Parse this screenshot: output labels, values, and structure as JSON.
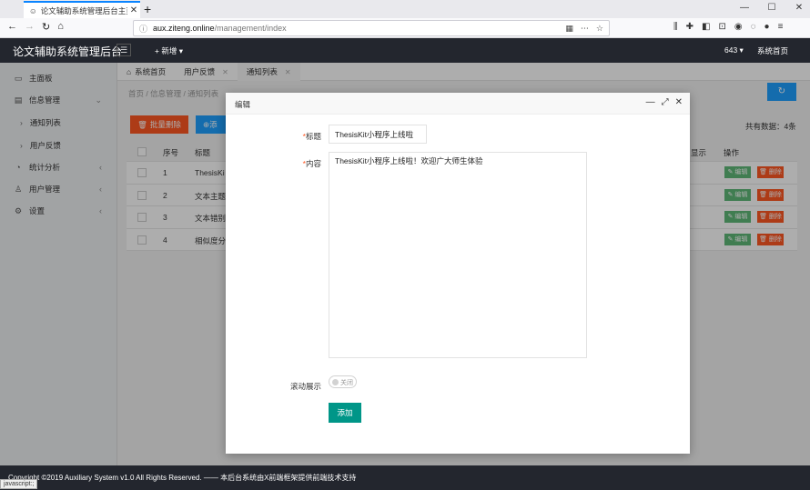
{
  "browser": {
    "tab_title": "论文辅助系统管理后台主页",
    "url_host": "aux.ziteng.online",
    "url_path": "/management/index"
  },
  "app": {
    "logo": "论文辅助系统管理后台",
    "add_new": "+ 新增",
    "user": "643",
    "home_link": "系统首页"
  },
  "sidebar": {
    "items": [
      {
        "label": "主面板",
        "icon": "dashboard-icon"
      },
      {
        "label": "信息管理",
        "icon": "info-icon"
      },
      {
        "label": "通知列表"
      },
      {
        "label": "用户反馈"
      },
      {
        "label": "统计分析",
        "icon": "chart-icon"
      },
      {
        "label": "用户管理",
        "icon": "user-icon"
      },
      {
        "label": "设置",
        "icon": "gear-icon"
      }
    ]
  },
  "page_tabs": [
    {
      "label": "系统首页"
    },
    {
      "label": "用户反馈"
    },
    {
      "label": "通知列表"
    }
  ],
  "breadcrumb": "首页  /  信息管理  /  通知列表",
  "toolbar": {
    "batch_delete": "批量删除",
    "add": "添"
  },
  "total": "共有数据：4条",
  "table": {
    "headers": {
      "no": "序号",
      "title": "标题",
      "show": "显示",
      "ops": "操作"
    },
    "rows": [
      {
        "no": "1",
        "title": "ThesisKi"
      },
      {
        "no": "2",
        "title": "文本主题"
      },
      {
        "no": "3",
        "title": "文本错别"
      },
      {
        "no": "4",
        "title": "相似度分"
      }
    ],
    "edit_label": "✎ 编辑",
    "delete_label": "🗑 删除"
  },
  "modal": {
    "title": "编辑",
    "title_label": "标题",
    "title_value": "ThesisKit小程序上线啦",
    "content_label": "内容",
    "content_value": "ThesisKit小程序上线啦！欢迎广大师生体验",
    "scroll_label": "滚动展示",
    "switch_text": "关闭",
    "submit": "添加"
  },
  "footer": "Copyright ©2019 Auxiliary System v1.0 All Rights Reserved. —— 本后台系统由X前端框架提供前端技术支持",
  "status_tip": "javascript:;"
}
